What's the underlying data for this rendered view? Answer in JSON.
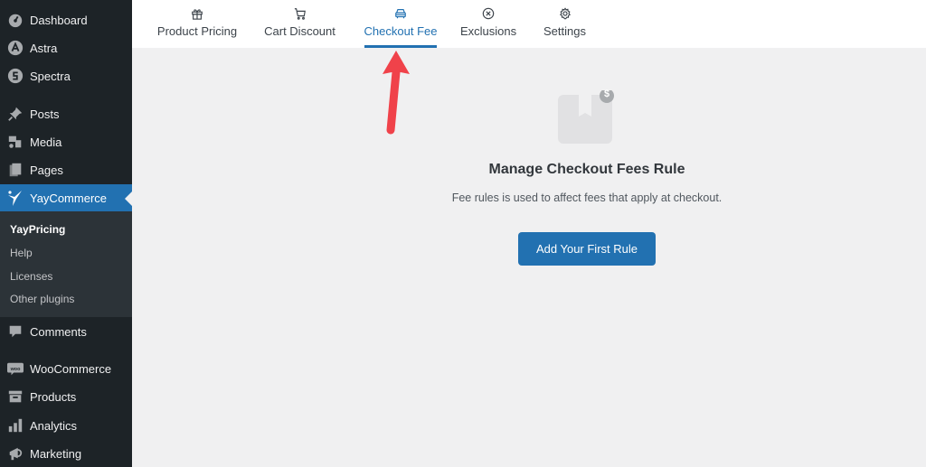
{
  "sidebar": {
    "items": [
      {
        "label": "Dashboard",
        "icon": "dashboard-icon"
      },
      {
        "label": "Astra",
        "icon": "astra-icon"
      },
      {
        "label": "Spectra",
        "icon": "spectra-icon"
      },
      {
        "label": "Posts",
        "icon": "pin-icon"
      },
      {
        "label": "Media",
        "icon": "media-icon"
      },
      {
        "label": "Pages",
        "icon": "pages-icon"
      },
      {
        "label": "YayCommerce",
        "icon": "yaycommerce-icon",
        "active": true
      },
      {
        "label": "Comments",
        "icon": "comment-icon"
      },
      {
        "label": "WooCommerce",
        "icon": "woo-icon"
      },
      {
        "label": "Products",
        "icon": "archive-icon"
      },
      {
        "label": "Analytics",
        "icon": "bar-chart-icon"
      },
      {
        "label": "Marketing",
        "icon": "megaphone-icon"
      }
    ],
    "submenu": [
      {
        "label": "YayPricing",
        "current": true
      },
      {
        "label": "Help"
      },
      {
        "label": "Licenses"
      },
      {
        "label": "Other plugins"
      }
    ]
  },
  "tabs": [
    {
      "label": "Product Pricing",
      "icon": "gift-icon"
    },
    {
      "label": "Cart Discount",
      "icon": "cart-icon"
    },
    {
      "label": "Checkout Fee",
      "icon": "car-icon",
      "active": true
    },
    {
      "label": "Exclusions",
      "icon": "close-circle-icon"
    },
    {
      "label": "Settings",
      "icon": "gear-icon"
    }
  ],
  "main": {
    "title": "Manage Checkout Fees Rule",
    "description": "Fee rules is used to affect fees that apply at checkout.",
    "button_label": "Add Your First Rule",
    "badge_symbol": "$"
  },
  "colors": {
    "accent": "#2271b1",
    "sidebar_bg": "#1d2327",
    "annotation_arrow": "#f0424a"
  }
}
